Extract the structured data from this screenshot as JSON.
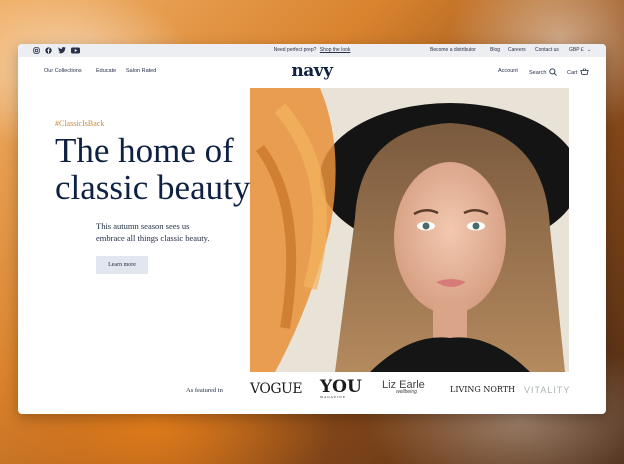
{
  "topbar": {
    "social_icons": [
      "instagram-icon",
      "facebook-icon",
      "twitter-icon",
      "youtube-icon"
    ],
    "promo_text": "Need perfect prep?",
    "promo_link": "Shop the look",
    "links": [
      "Become a distributor",
      "Blog",
      "Careers",
      "Contact us"
    ],
    "currency": "GBP £"
  },
  "nav": {
    "left": [
      "Our Collections",
      "Educate",
      "Salon Rated"
    ],
    "logo": "navy",
    "account": "Account",
    "search": "Search",
    "cart": "Cart"
  },
  "hero": {
    "tag": "#ClassicIsBack",
    "title_line1": "The home of",
    "title_line2": "classic beauty",
    "subtitle_line1": "This autumn season sees us",
    "subtitle_line2": "embrace all things classic beauty.",
    "button": "Learn more"
  },
  "featured": {
    "label": "As featured in",
    "brands": [
      "VOGUE",
      "YOU",
      "Liz Earle",
      "LIVING NORTH",
      "VITALITY"
    ],
    "brand_sublabels": {
      "YOU": "MAGAZINE",
      "Liz Earle": "wellbeing"
    }
  },
  "colors": {
    "navy": "#0f2142",
    "accent": "#c98a3a",
    "topbar": "#eceef2",
    "button": "#e2e6ee"
  }
}
